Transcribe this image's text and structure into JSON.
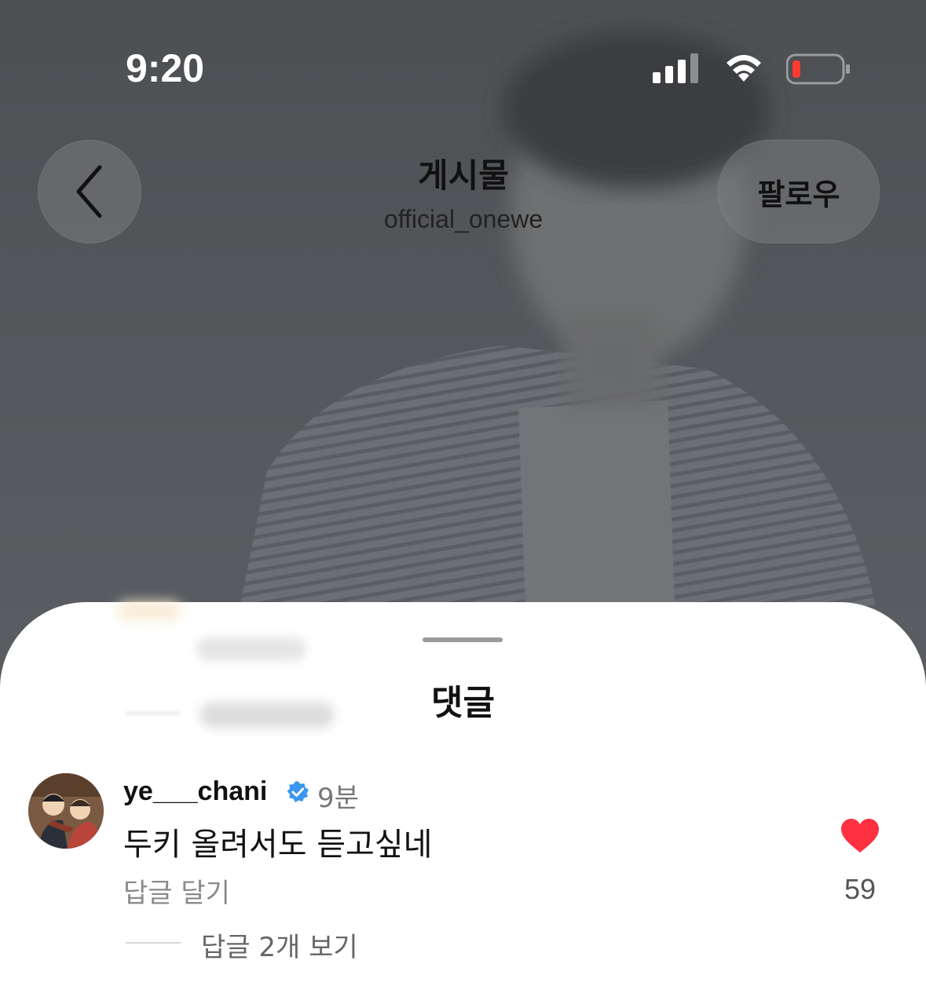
{
  "status_bar": {
    "time": "9:20",
    "signal_icon": "signal-icon",
    "wifi_icon": "wifi-icon",
    "battery_icon": "battery-low-icon",
    "battery_color": "#ff3b30"
  },
  "header": {
    "back_icon": "chevron-left-icon",
    "title": "게시물",
    "subtitle": "official_onewe",
    "follow_label": "팔로우"
  },
  "sheet": {
    "title": "댓글",
    "comment": {
      "username": "ye___chani",
      "verified_icon": "verified-badge-icon",
      "time_ago": "9분",
      "text": "두키 올려서도 듣고싶네",
      "reply_label": "답글 달기",
      "like_icon": "heart-filled-icon",
      "like_color": "#ff3040",
      "like_count": "59",
      "view_replies_label": "답글 2개 보기"
    }
  }
}
